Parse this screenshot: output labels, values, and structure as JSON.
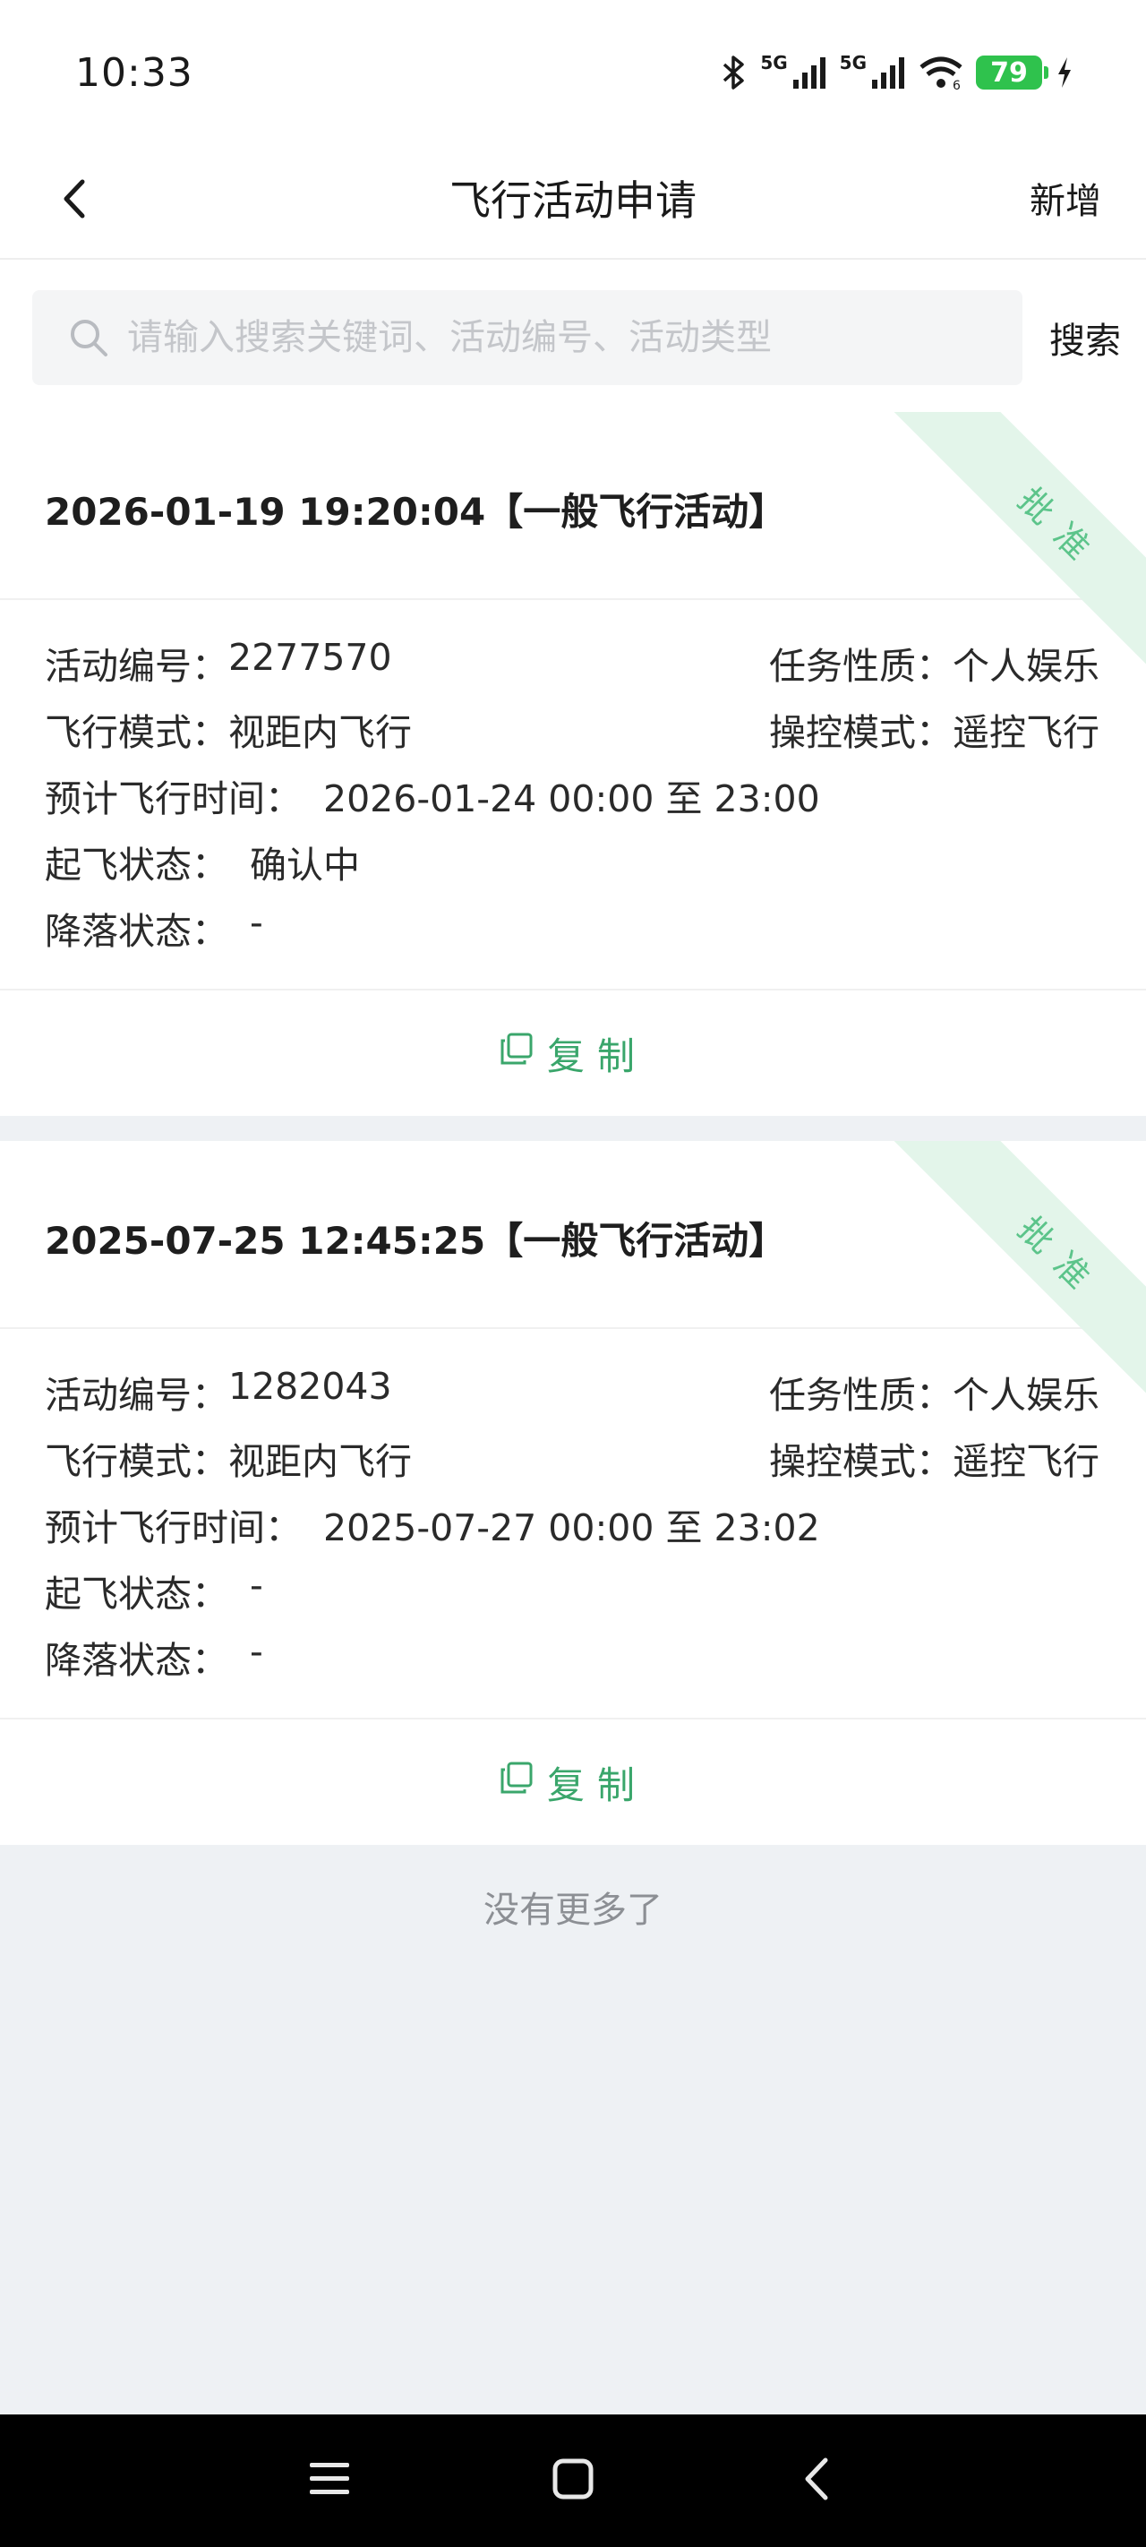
{
  "status_bar": {
    "time": "10:33",
    "network_1": "5G",
    "network_2": "5G",
    "wifi_sub": "6",
    "battery": "79",
    "icons": [
      "bluetooth-icon",
      "signal-icon",
      "signal-icon",
      "wifi-icon",
      "battery-icon",
      "charging-icon"
    ]
  },
  "nav": {
    "back_icon": "chevron-left-icon",
    "title": "飞行活动申请",
    "add_label": "新增"
  },
  "search": {
    "icon": "search-icon",
    "placeholder": "请输入搜索关键词、活动编号、活动类型",
    "value": "",
    "button_label": "搜索"
  },
  "records": [
    {
      "title": "2026-01-19 19:20:04【一般飞行活动】",
      "status": "批准",
      "activity_no_label": "活动编号：",
      "activity_no": "2277570",
      "task_nature_label": "任务性质：",
      "task_nature": "个人娱乐",
      "flight_mode_label": "飞行模式：",
      "flight_mode": "视距内飞行",
      "control_mode_label": "操控模式：",
      "control_mode": "遥控飞行",
      "planned_time_label": "预计飞行时间：",
      "planned_time": "2026-01-24 00:00 至 23:00",
      "takeoff_label": "起飞状态：",
      "takeoff_status": "确认中",
      "landing_label": "降落状态：",
      "landing_status": "-",
      "copy_label": "复制"
    },
    {
      "title": "2025-07-25 12:45:25【一般飞行活动】",
      "status": "批准",
      "activity_no_label": "活动编号：",
      "activity_no": "1282043",
      "task_nature_label": "任务性质：",
      "task_nature": "个人娱乐",
      "flight_mode_label": "飞行模式：",
      "flight_mode": "视距内飞行",
      "control_mode_label": "操控模式：",
      "control_mode": "遥控飞行",
      "planned_time_label": "预计飞行时间：",
      "planned_time": "2025-07-27 00:00 至 23:02",
      "takeoff_label": "起飞状态：",
      "takeoff_status": "-",
      "landing_label": "降落状态：",
      "landing_status": "-",
      "copy_label": "复制"
    }
  ],
  "list_end_text": "没有更多了",
  "colors": {
    "accent": "#3aa66b",
    "ribbon_bg": "#e3f5ea",
    "ribbon_text": "#5cc48a",
    "page_bg": "#eef1f4",
    "battery": "#2fc24d"
  }
}
